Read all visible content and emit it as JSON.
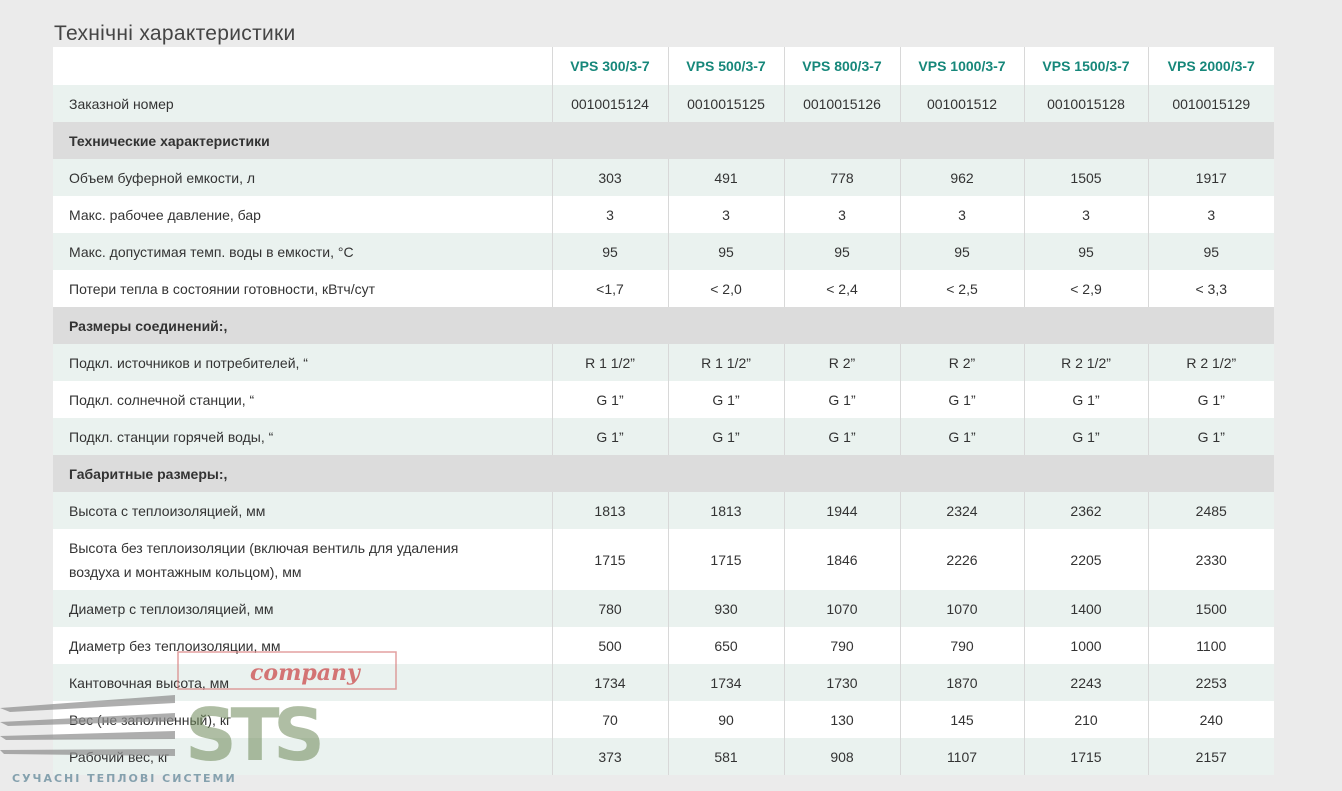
{
  "page": {
    "title": "Технічні характеристики"
  },
  "table": {
    "columns": [
      "VPS 300/3-7",
      "VPS 500/3-7",
      "VPS 800/3-7",
      "VPS 1000/3-7",
      "VPS 1500/3-7",
      "VPS 2000/3-7"
    ],
    "order_row": {
      "label": "Заказной номер",
      "values": [
        "0010015124",
        "0010015125",
        "0010015126",
        "001001512",
        "0010015128",
        "0010015129"
      ]
    },
    "sections": [
      {
        "title": "Технические характеристики",
        "rows": [
          {
            "label": "Объем буферной емкости, л",
            "values": [
              "303",
              "491",
              "778",
              "962",
              "1505",
              "1917"
            ]
          },
          {
            "label": "Макс. рабочее давление, бар",
            "values": [
              "3",
              "3",
              "3",
              "3",
              "3",
              "3"
            ]
          },
          {
            "label": "Макс. допустимая темп. воды в емкости, °С",
            "values": [
              "95",
              "95",
              "95",
              "95",
              "95",
              "95"
            ]
          },
          {
            "label": "Потери тепла в состоянии готовности, кВтч/сут",
            "values": [
              "<1,7",
              "< 2,0",
              "< 2,4",
              "< 2,5",
              "< 2,9",
              "< 3,3"
            ]
          }
        ]
      },
      {
        "title": "Размеры соединений:,",
        "rows": [
          {
            "label": "Подкл. источников и потребителей, “",
            "values": [
              "R 1 1/2”",
              "R 1 1/2”",
              "R 2”",
              "R 2”",
              "R 2 1/2”",
              "R 2 1/2”"
            ]
          },
          {
            "label": "Подкл. солнечной станции, “",
            "values": [
              "G 1”",
              "G 1”",
              "G 1”",
              "G 1”",
              "G 1”",
              "G 1”"
            ]
          },
          {
            "label": "Подкл. станции горячей воды, “",
            "values": [
              "G 1”",
              "G 1”",
              "G 1”",
              "G 1”",
              "G 1”",
              "G 1”"
            ]
          }
        ]
      },
      {
        "title": "Габаритные размеры:,",
        "rows": [
          {
            "label": "Высота с теплоизоляцией, мм",
            "values": [
              "1813",
              "1813",
              "1944",
              "2324",
              "2362",
              "2485"
            ]
          },
          {
            "label": "Высота без теплоизоляции (включая вентиль для удаления воздуха и монтажным кольцом), мм",
            "values": [
              "1715",
              "1715",
              "1846",
              "2226",
              "2205",
              "2330"
            ]
          },
          {
            "label": "Диаметр с теплоизоляцией, мм",
            "values": [
              "780",
              "930",
              "1070",
              "1070",
              "1400",
              "1500"
            ]
          },
          {
            "label": "Диаметр без теплоизоляции, мм",
            "values": [
              "500",
              "650",
              "790",
              "790",
              "1000",
              "1100"
            ]
          },
          {
            "label": "Кантовочная высота, мм",
            "values": [
              "1734",
              "1734",
              "1730",
              "1870",
              "2243",
              "2253"
            ]
          },
          {
            "label": "Вес (не заполненный), кг",
            "values": [
              "70",
              "90",
              "130",
              "145",
              "210",
              "240"
            ]
          },
          {
            "label": "Рабочий вес, кг",
            "values": [
              "373",
              "581",
              "908",
              "1107",
              "1715",
              "2157"
            ]
          }
        ]
      }
    ]
  },
  "watermark": {
    "brand": "STS",
    "script": "company",
    "tagline": "СУЧАСНІ ТЕПЛОВІ СИСТЕМИ"
  },
  "colors": {
    "accent": "#16877a",
    "section_bg": "#dcdcdc",
    "row_alt": "#eaf2ef",
    "page_bg": "#ebebeb"
  }
}
